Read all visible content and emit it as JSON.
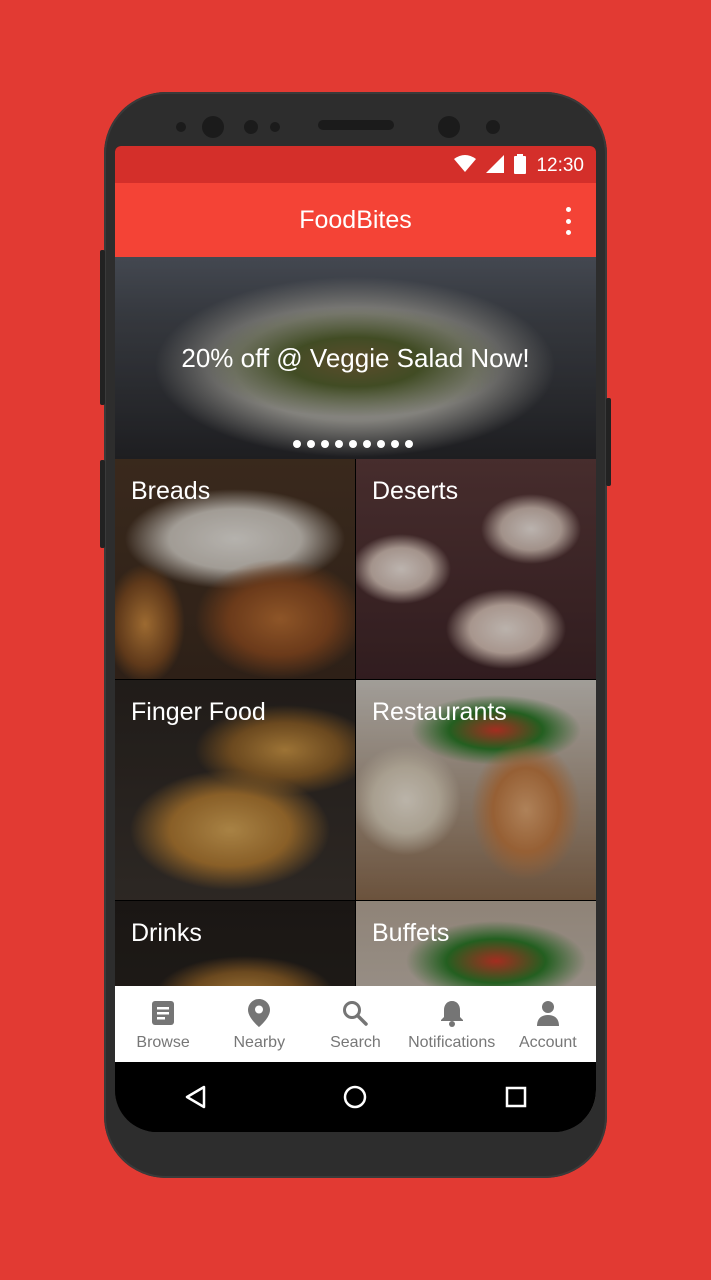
{
  "status_bar": {
    "time": "12:30"
  },
  "app_bar": {
    "title": "FoodBites"
  },
  "banner": {
    "promo_text": "20% off @ Veggie Salad Now!",
    "page_count": 9
  },
  "categories": [
    {
      "label": "Breads"
    },
    {
      "label": "Deserts"
    },
    {
      "label": "Finger Food"
    },
    {
      "label": "Restaurants"
    },
    {
      "label": "Drinks"
    },
    {
      "label": "Buffets"
    }
  ],
  "bottom_nav": [
    {
      "label": "Browse",
      "icon": "document-icon"
    },
    {
      "label": "Nearby",
      "icon": "location-pin-icon"
    },
    {
      "label": "Search",
      "icon": "search-icon"
    },
    {
      "label": "Notifications",
      "icon": "bell-icon"
    },
    {
      "label": "Account",
      "icon": "person-icon"
    }
  ],
  "colors": {
    "primary": "#f44336",
    "primary_dark": "#d42f2a",
    "background": "#e23a33",
    "nav_text": "#777777"
  }
}
